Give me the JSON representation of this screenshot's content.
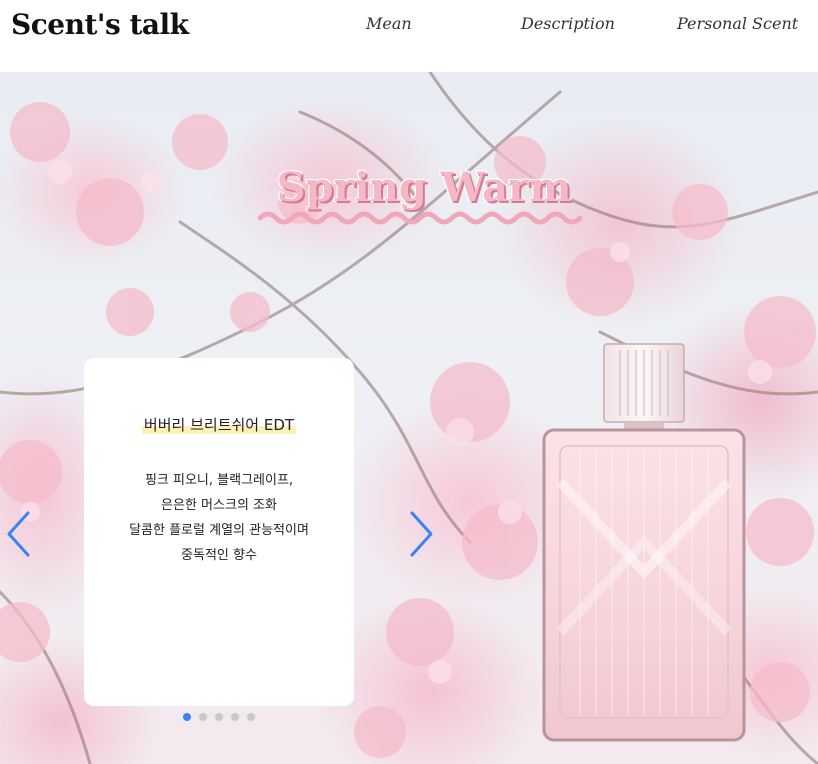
{
  "header": {
    "brand": "Scent's talk",
    "nav": [
      "Mean",
      "Description",
      "Personal Scent"
    ]
  },
  "hero": {
    "title": "Spring Warm",
    "card": {
      "name": "버버리 브리트쉬어 EDT",
      "description": [
        "핑크 피오니, 블랙그레이프,",
        "은은한 머스크의 조화",
        "달콤한 플로럴 계열의 관능적이며",
        "중독적인 향수"
      ]
    },
    "carousel": {
      "slide_count": 5,
      "active_index": 0
    }
  },
  "colors": {
    "accent": "#3b82f6",
    "title_pink": "#f4b8c6",
    "highlight": "#fbf1b8"
  },
  "icons": {
    "prev": "chevron-left-icon",
    "next": "chevron-right-icon"
  }
}
